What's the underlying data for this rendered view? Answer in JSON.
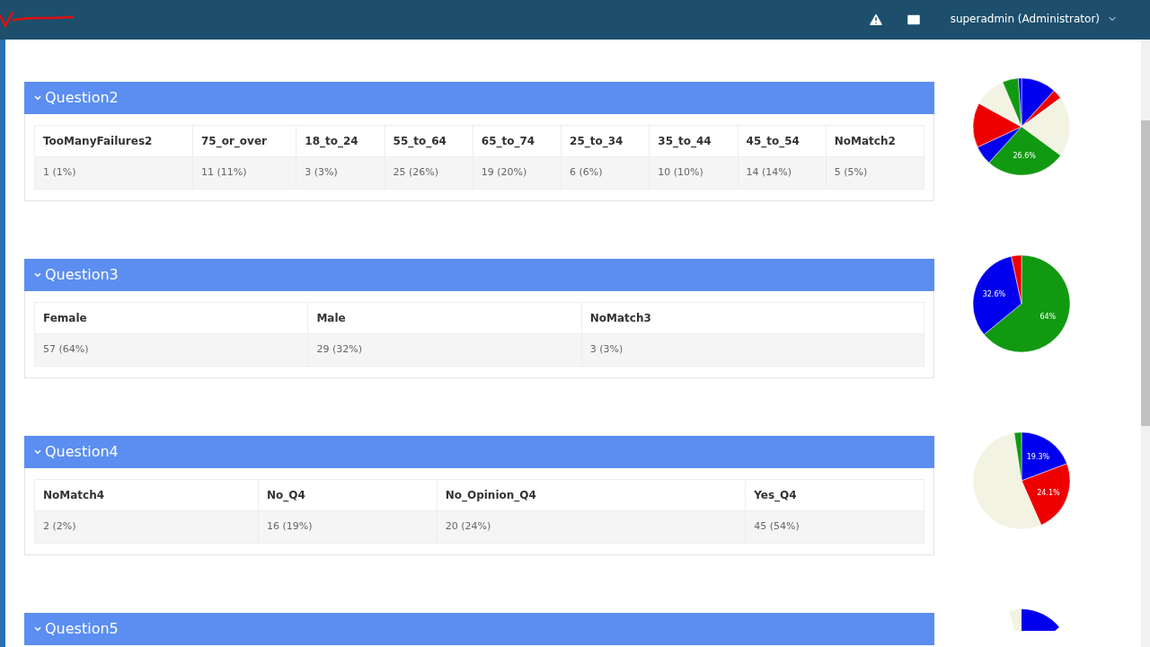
{
  "header": {
    "user_menu": "superadmin (Administrator)"
  },
  "sections": [
    {
      "title": "Question2",
      "expanded": true,
      "columns": [
        {
          "heading": "TooManyFailures2",
          "value": "1 (1%)"
        },
        {
          "heading": "75_or_over",
          "value": "11 (11%)"
        },
        {
          "heading": "18_to_24",
          "value": "3 (3%)"
        },
        {
          "heading": "55_to_64",
          "value": "25 (26%)"
        },
        {
          "heading": "65_to_74",
          "value": "19 (20%)"
        },
        {
          "heading": "25_to_34",
          "value": "6 (6%)"
        },
        {
          "heading": "35_to_44",
          "value": "10 (10%)"
        },
        {
          "heading": "45_to_54",
          "value": "14 (14%)"
        },
        {
          "heading": "NoMatch2",
          "value": "5 (5%)"
        }
      ],
      "pie_labels": [
        "26.6%"
      ]
    },
    {
      "title": "Question3",
      "expanded": true,
      "columns": [
        {
          "heading": "Female",
          "value": "57 (64%)"
        },
        {
          "heading": "Male",
          "value": "29 (32%)"
        },
        {
          "heading": "NoMatch3",
          "value": "3 (3%)"
        }
      ],
      "pie_labels": [
        "64%",
        "32.6%"
      ]
    },
    {
      "title": "Question4",
      "expanded": true,
      "columns": [
        {
          "heading": "NoMatch4",
          "value": "2 (2%)"
        },
        {
          "heading": "No_Q4",
          "value": "16 (19%)"
        },
        {
          "heading": "No_Opinion_Q4",
          "value": "20 (24%)"
        },
        {
          "heading": "Yes_Q4",
          "value": "45 (54%)"
        }
      ],
      "pie_labels": [
        "19.3%",
        "24.1%"
      ]
    },
    {
      "title": "Question5",
      "expanded": true
    }
  ]
}
